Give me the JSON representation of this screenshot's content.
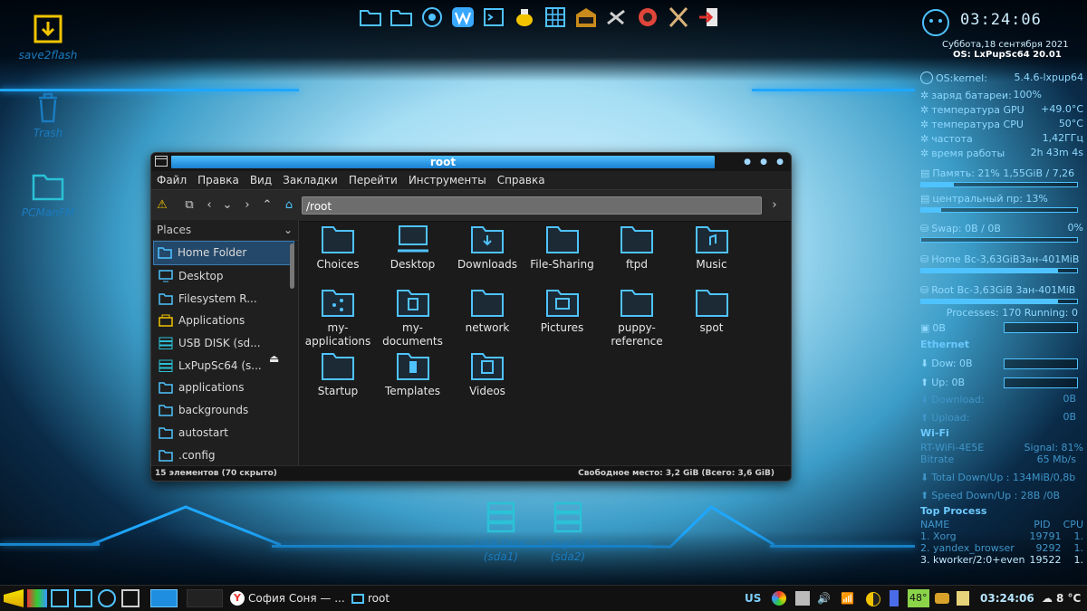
{
  "launcher": {
    "icons": [
      "folder-icon",
      "folder-icon",
      "browser-icon",
      "writer-icon",
      "terminal-icon",
      "teapot-icon",
      "spreadsheet-icon",
      "sfs-package-icon",
      "tools-icon",
      "aperture-icon",
      "xorg-icon",
      "exit-icon"
    ]
  },
  "desktop": {
    "icons": [
      {
        "label": "save2flash",
        "icon": "save2flash-icon"
      },
      {
        "label": "Trash",
        "icon": "trash-icon"
      },
      {
        "label": "PCManFM",
        "icon": "folder-icon"
      },
      {
        "label": "USB DISK",
        "sublabel": "(sda1)",
        "icon": "drive-icon"
      },
      {
        "label": "LxPupSc64",
        "sublabel": "(sda2)",
        "icon": "drive-icon"
      }
    ]
  },
  "conky": {
    "clock": "03:24:06",
    "date": "Суббота,18 сентября 2021",
    "os": "OS: LxPupSc64 20.01",
    "kernel_label": "OS:kernel:",
    "kernel_value": "5.4.6-lxpup64",
    "battery_label": "заряд батареи:",
    "battery_value": "100%",
    "gpu_label": "температура  GPU",
    "gpu_value": "+49.0°C",
    "cpu_temp_label": "температура  CPU",
    "cpu_temp_value": "50°C",
    "freq_label": "частота",
    "freq_value": "1,42ГГц",
    "uptime_label": "время работы",
    "uptime_value": "2h 43m 4s",
    "memory": "Память: 21% 1,55GiB / 7,26",
    "memory_level": 0.21,
    "cpu": "центральный пр: 13%",
    "cpu_level": 0.13,
    "swap": "Swap: 0B   / 0B",
    "swap_pct": "0%",
    "home": "Home Bc-3,63GiB3ан-401MiB",
    "root": "Root Bc-3,63GiB 3ан-401MiB",
    "processes": "Processes: 170 Running: 0",
    "proc_zero": "0B",
    "ethernet": "Ethernet",
    "down": "Dow: 0B",
    "up": "Up: 0B",
    "download_label": "Download:",
    "download_value": "0B",
    "upload_label": "Upload:",
    "upload_value": "0B",
    "wifi": "Wi-Fi",
    "wifi_ssid": "RT-WiFi-4E5E",
    "wifi_signal": "Signal: 81%",
    "bitrate_label": "Bitrate",
    "bitrate_value": "65 Mb/s",
    "total": "Total Down/Up : 134MiB/0,8b",
    "speed": "Speed Down/Up : 28B /0B",
    "top_process": "Top Process",
    "col_name": "NAME",
    "col_pid": "PID",
    "col_cpu": "CPU",
    "procs": [
      {
        "name": "1. Xorg",
        "pid": "19791",
        "cpu": "1."
      },
      {
        "name": "2. yandex_browser",
        "pid": "9292",
        "cpu": "1."
      },
      {
        "name": "3. kworker/2:0+even",
        "pid": "19522",
        "cpu": "1."
      }
    ]
  },
  "window": {
    "title": "root",
    "menu": [
      "Файл",
      "Правка",
      "Вид",
      "Закладки",
      "Перейти",
      "Инструменты",
      "Справка"
    ],
    "path": "/root",
    "places_label": "Places",
    "places": [
      {
        "label": "Home Folder",
        "icon": "home-folder-icon",
        "selected": true
      },
      {
        "label": "Desktop",
        "icon": "desktop-icon"
      },
      {
        "label": "Filesystem R...",
        "icon": "folder-icon"
      },
      {
        "label": "Applications",
        "icon": "applications-icon"
      },
      {
        "label": "USB DISK (sd...",
        "icon": "drive-icon"
      },
      {
        "label": "LxPupSc64 (s...",
        "icon": "drive-icon"
      },
      {
        "label": "applications",
        "icon": "folder-icon"
      },
      {
        "label": "backgrounds",
        "icon": "folder-icon"
      },
      {
        "label": "autostart",
        "icon": "folder-icon"
      },
      {
        "label": ".config",
        "icon": "folder-icon"
      }
    ],
    "files": [
      {
        "name": "Choices",
        "icon": "folder-icon"
      },
      {
        "name": "Desktop",
        "icon": "desktop-folder-icon"
      },
      {
        "name": "Downloads",
        "icon": "downloads-folder-icon"
      },
      {
        "name": "File-Sharing",
        "icon": "folder-icon"
      },
      {
        "name": "ftpd",
        "icon": "folder-icon"
      },
      {
        "name": "Music",
        "icon": "music-folder-icon"
      },
      {
        "name": "my-\napplications",
        "icon": "share-folder-icon"
      },
      {
        "name": "my-\ndocuments",
        "icon": "documents-folder-icon"
      },
      {
        "name": "network",
        "icon": "folder-icon"
      },
      {
        "name": "Pictures",
        "icon": "pictures-folder-icon"
      },
      {
        "name": "puppy-\nreference",
        "icon": "folder-icon"
      },
      {
        "name": "spot",
        "icon": "folder-icon"
      },
      {
        "name": "Startup",
        "icon": "folder-icon"
      },
      {
        "name": "Templates",
        "icon": "templates-folder-icon"
      },
      {
        "name": "Videos",
        "icon": "videos-folder-icon"
      }
    ],
    "status_left": "15 элементов (70 скрыто)",
    "status_right": "Свободное место: 3,2 GiB (Всего: 3,6 GiB)"
  },
  "taskbar": {
    "tasks": [
      {
        "label": "София Соня — ...",
        "icon": "yandex-browser-icon"
      },
      {
        "label": "root",
        "icon": "folder-icon"
      }
    ],
    "layout": "US",
    "battery": "48°",
    "clock": "03:24:06",
    "weather": "8 °C"
  },
  "colors": {
    "accent": "#1ea7ff",
    "neon": "#4fc3ff",
    "selection": "#24486a"
  }
}
